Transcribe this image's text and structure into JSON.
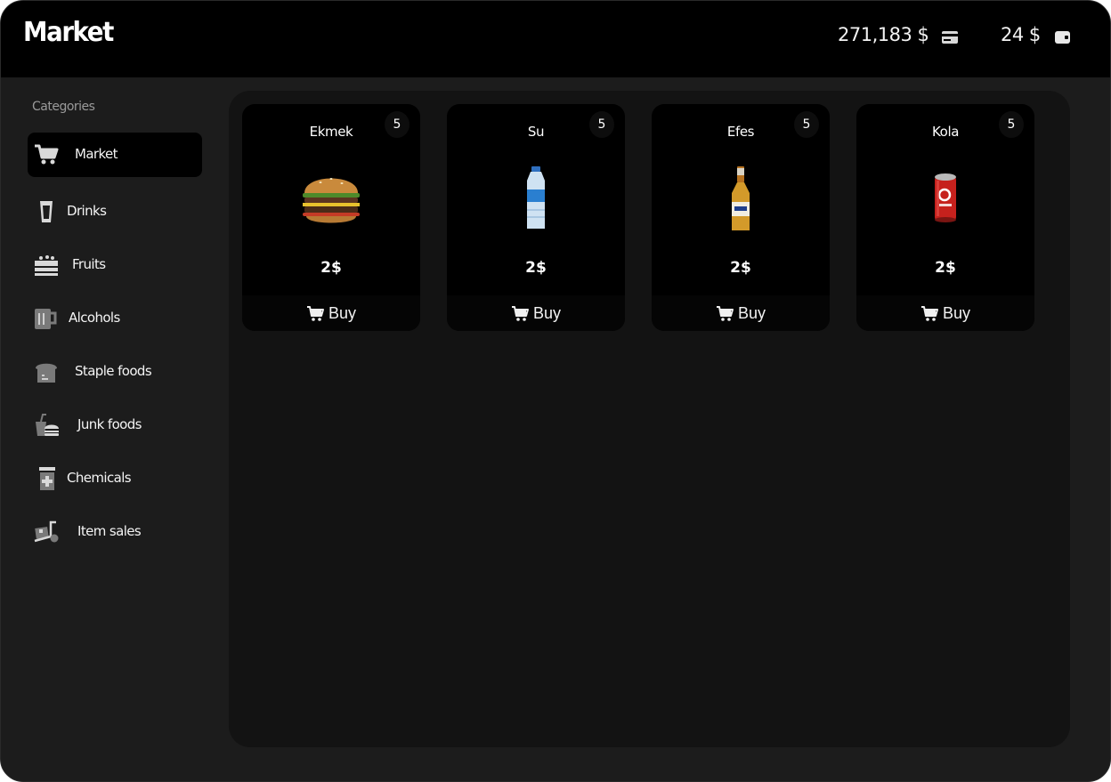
{
  "header": {
    "title": "Market",
    "bank_balance": "271,183 $",
    "cash_balance": "24 $",
    "bank_icon": "credit-card-icon",
    "cash_icon": "wallet-icon"
  },
  "sidebar": {
    "label": "Categories",
    "items": [
      {
        "label": "Market",
        "icon": "cart-icon",
        "active": true
      },
      {
        "label": "Drinks",
        "icon": "glass-icon"
      },
      {
        "label": "Fruits",
        "icon": "fruit-basket-icon"
      },
      {
        "label": "Alcohols",
        "icon": "beer-mug-icon"
      },
      {
        "label": "Staple foods",
        "icon": "bread-icon"
      },
      {
        "label": "Junk foods",
        "icon": "burger-soda-icon"
      },
      {
        "label": "Chemicals",
        "icon": "medicine-bottle-icon"
      },
      {
        "label": "Item sales",
        "icon": "hand-truck-icon"
      }
    ]
  },
  "products": [
    {
      "name": "Ekmek",
      "count": "5",
      "price": "2$",
      "buy_label": "Buy",
      "image": "burger-image"
    },
    {
      "name": "Su",
      "count": "5",
      "price": "2$",
      "buy_label": "Buy",
      "image": "water-bottle-image"
    },
    {
      "name": "Efes",
      "count": "5",
      "price": "2$",
      "buy_label": "Buy",
      "image": "beer-bottle-image"
    },
    {
      "name": "Kola",
      "count": "5",
      "price": "2$",
      "buy_label": "Buy",
      "image": "cola-can-image"
    }
  ],
  "colors": {
    "background": "#1c1c1c",
    "header": "#000000",
    "content_panel": "#131313",
    "card": "#000000"
  }
}
